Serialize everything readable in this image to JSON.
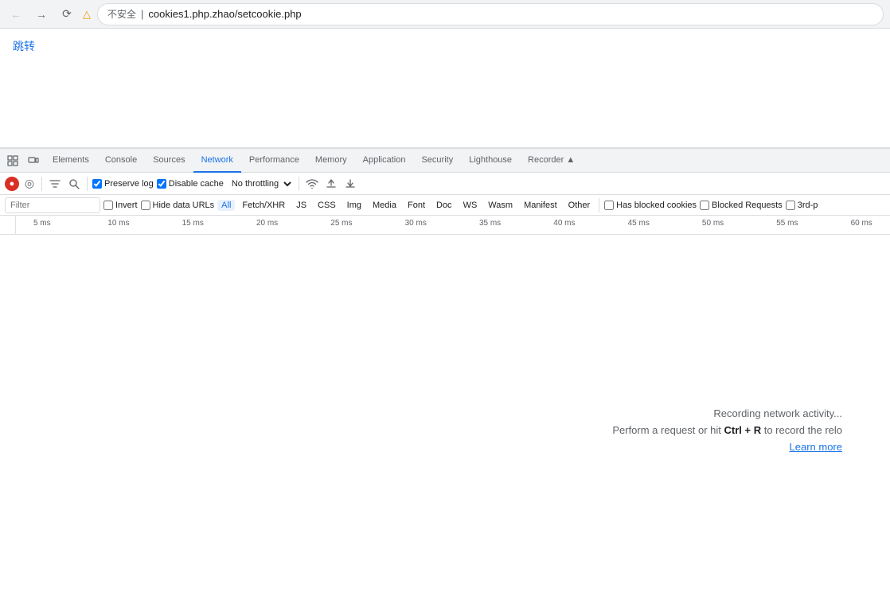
{
  "browser": {
    "back_disabled": true,
    "forward_disabled": true,
    "url_display": "cookies1.php.zhao/setcookie.php",
    "security_label": "不安全",
    "warning_char": "⚠"
  },
  "page": {
    "link_text": "跳转"
  },
  "devtools": {
    "tabs": [
      {
        "id": "elements",
        "label": "Elements",
        "active": false
      },
      {
        "id": "console",
        "label": "Console",
        "active": false
      },
      {
        "id": "sources",
        "label": "Sources",
        "active": false
      },
      {
        "id": "network",
        "label": "Network",
        "active": true
      },
      {
        "id": "performance",
        "label": "Performance",
        "active": false
      },
      {
        "id": "memory",
        "label": "Memory",
        "active": false
      },
      {
        "id": "application",
        "label": "Application",
        "active": false
      },
      {
        "id": "security",
        "label": "Security",
        "active": false
      },
      {
        "id": "lighthouse",
        "label": "Lighthouse",
        "active": false
      },
      {
        "id": "recorder",
        "label": "Recorder ▲",
        "active": false
      }
    ],
    "toolbar": {
      "preserve_log_label": "Preserve log",
      "preserve_log_checked": true,
      "disable_cache_label": "Disable cache",
      "disable_cache_checked": true,
      "throttling_label": "No throttling"
    },
    "filter": {
      "placeholder": "Filter",
      "invert_label": "Invert",
      "hide_data_urls_label": "Hide data URLs",
      "types": [
        "All",
        "Fetch/XHR",
        "JS",
        "CSS",
        "Img",
        "Media",
        "Font",
        "Doc",
        "WS",
        "Wasm",
        "Manifest",
        "Other"
      ],
      "active_type": "All",
      "has_blocked_cookies_label": "Has blocked cookies",
      "blocked_requests_label": "Blocked Requests",
      "third_party_label": "3rd-p"
    },
    "timeline": {
      "ticks": [
        {
          "label": "5 ms",
          "left_pct": 2
        },
        {
          "label": "10 ms",
          "left_pct": 10.5
        },
        {
          "label": "15 ms",
          "left_pct": 19
        },
        {
          "label": "20 ms",
          "left_pct": 27.5
        },
        {
          "label": "25 ms",
          "left_pct": 36
        },
        {
          "label": "30 ms",
          "left_pct": 44.5
        },
        {
          "label": "35 ms",
          "left_pct": 53
        },
        {
          "label": "40 ms",
          "left_pct": 61.5
        },
        {
          "label": "45 ms",
          "left_pct": 70
        },
        {
          "label": "50 ms",
          "left_pct": 78.5
        },
        {
          "label": "55 ms",
          "left_pct": 87
        },
        {
          "label": "60 ms",
          "left_pct": 95.5
        }
      ]
    },
    "recording_message": {
      "line1": "Recording network activity...",
      "line2_prefix": "Perform a request or hit ",
      "line2_shortcut": "Ctrl + R",
      "line2_suffix": " to record the relo",
      "line3": "Learn more"
    }
  }
}
